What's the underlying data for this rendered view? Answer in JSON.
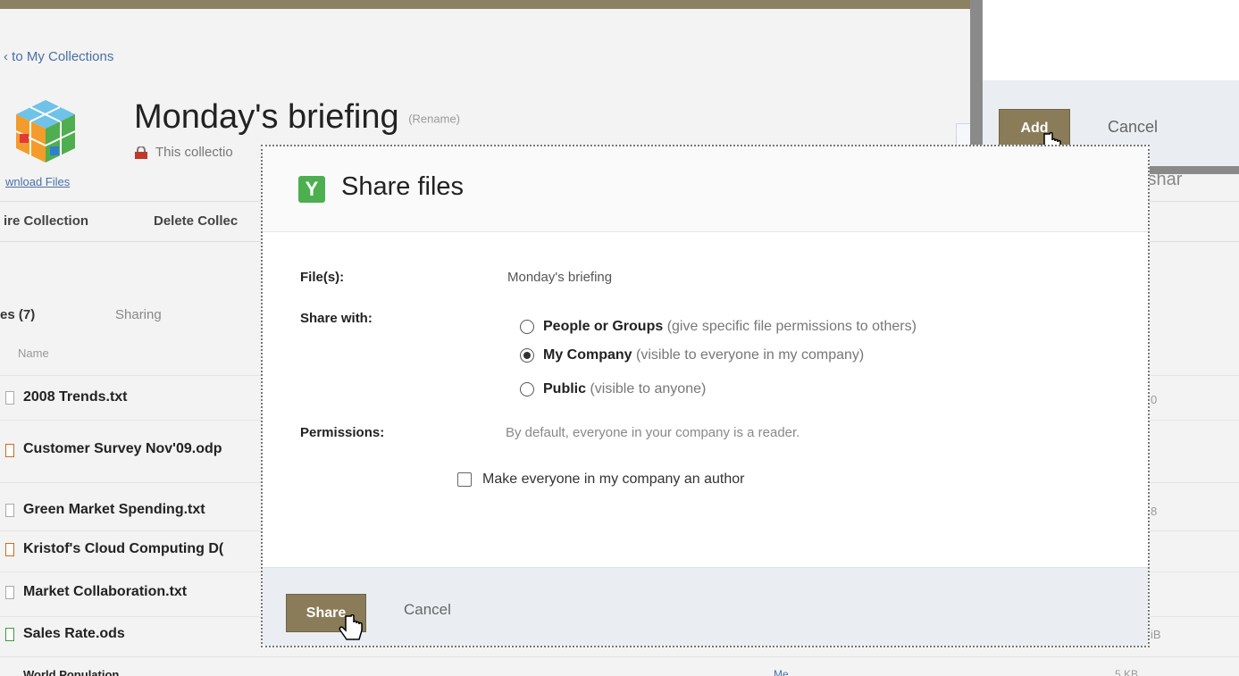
{
  "page": {
    "back_link": "‹ to My Collections",
    "download_link": "wnload Files",
    "collection_title": "Monday's briefing",
    "rename_label": "(Rename)",
    "collection_subtitle": "This collectio",
    "actions": [
      "ire Collection",
      "Delete Collec"
    ],
    "tabs": {
      "files": "es (7)",
      "sharing": "Sharing"
    },
    "column_name": "Name",
    "files": [
      "2008 Trends.txt",
      "Customer Survey Nov'09.odp",
      "Green Market Spending.txt",
      "Kristof's Cloud Computing D(",
      "Market Collaboration.txt",
      "Sales Rate.ods",
      "World Population"
    ],
    "right_fragments": [
      "0",
      "8",
      "iB"
    ],
    "bottom_fragments": [
      "Me",
      "5 KB"
    ],
    "shared_fragment": "This file is shar"
  },
  "add_dialog": {
    "add_label": "Add",
    "cancel_label": "Cancel"
  },
  "share_modal": {
    "title": "Share files",
    "files_label": "File(s):",
    "files_value": "Monday's briefing",
    "share_with_label": "Share with:",
    "options": [
      {
        "label": "People or Groups",
        "note": "(give specific file permissions to others)",
        "selected": false
      },
      {
        "label": "My Company",
        "note": "(visible to everyone in my company)",
        "selected": true
      },
      {
        "label": "Public",
        "note": "(visible to anyone)",
        "selected": false
      }
    ],
    "permissions_label": "Permissions:",
    "permissions_text": "By default, everyone in your company is a reader.",
    "author_checkbox": "Make everyone in my company an author",
    "author_checked": false,
    "share_button": "Share",
    "cancel_button": "Cancel"
  },
  "colors": {
    "button_brown": "#8a7c58",
    "footer_bg": "#eaeef3",
    "link_blue": "#4a6fa5",
    "logo_green": "#4caf50"
  }
}
